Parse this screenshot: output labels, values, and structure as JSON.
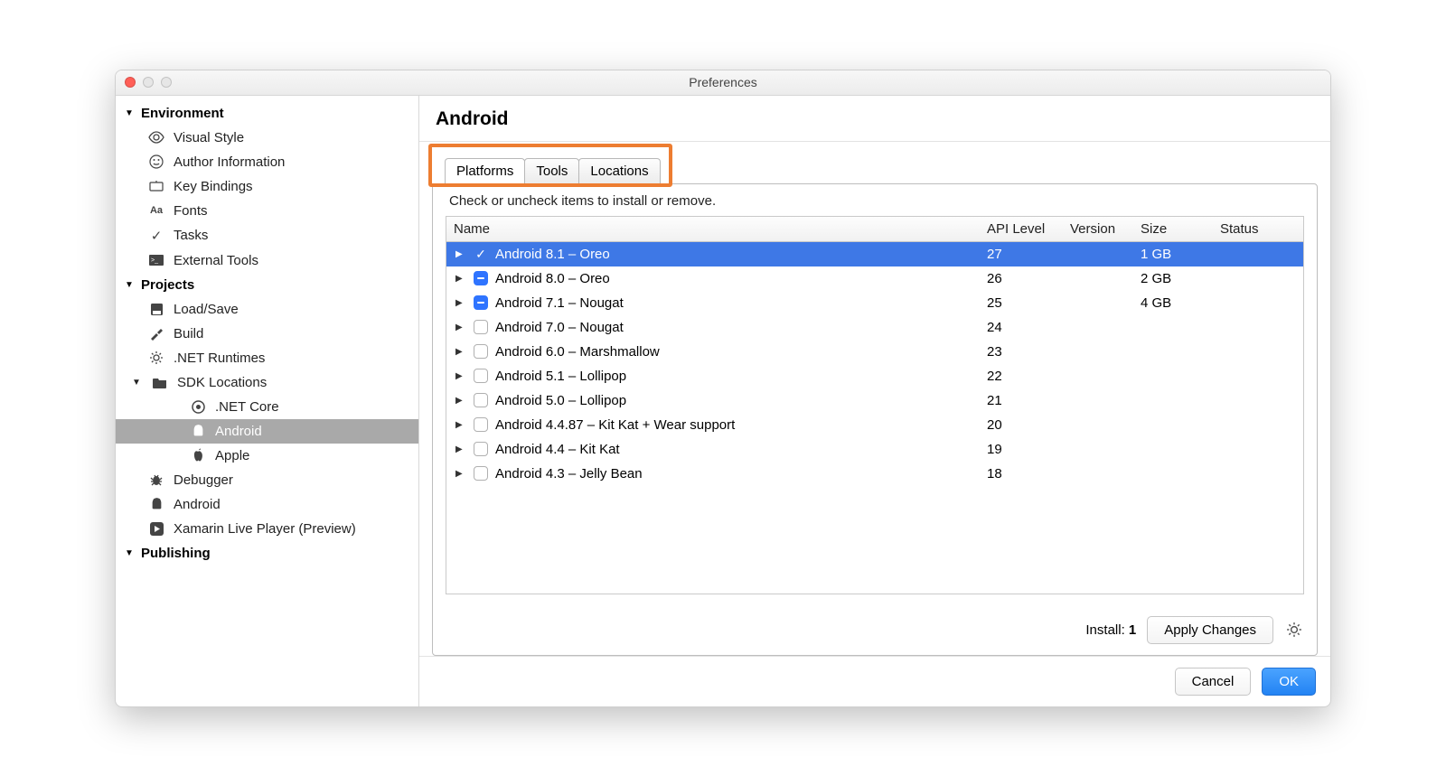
{
  "window": {
    "title": "Preferences"
  },
  "sidebar": {
    "sections": {
      "environment": {
        "label": "Environment",
        "items": [
          {
            "label": "Visual Style"
          },
          {
            "label": "Author Information"
          },
          {
            "label": "Key Bindings"
          },
          {
            "label": "Fonts"
          },
          {
            "label": "Tasks"
          },
          {
            "label": "External Tools"
          }
        ]
      },
      "projects": {
        "label": "Projects",
        "items": {
          "loadsave": {
            "label": "Load/Save"
          },
          "build": {
            "label": "Build"
          },
          "netruntimes": {
            "label": ".NET Runtimes"
          },
          "sdk": {
            "label": "SDK Locations",
            "children": {
              "netcore": {
                "label": ".NET Core"
              },
              "android": {
                "label": "Android"
              },
              "apple": {
                "label": "Apple"
              }
            }
          },
          "debugger": {
            "label": "Debugger"
          },
          "android2": {
            "label": "Android"
          },
          "xamarin": {
            "label": "Xamarin Live Player (Preview)"
          }
        }
      },
      "publishing": {
        "label": "Publishing"
      }
    }
  },
  "main": {
    "title": "Android",
    "tabs": {
      "platforms": "Platforms",
      "tools": "Tools",
      "locations": "Locations"
    },
    "hint": "Check or uncheck items to install or remove.",
    "columns": {
      "name": "Name",
      "api": "API Level",
      "version": "Version",
      "size": "Size",
      "status": "Status"
    },
    "rows": [
      {
        "check": "checked",
        "selected": true,
        "name": "Android 8.1 – Oreo",
        "api": "27",
        "version": "",
        "size": "1 GB",
        "status": ""
      },
      {
        "check": "mixed",
        "selected": false,
        "name": "Android 8.0 – Oreo",
        "api": "26",
        "version": "",
        "size": "2 GB",
        "status": ""
      },
      {
        "check": "mixed",
        "selected": false,
        "name": "Android 7.1 – Nougat",
        "api": "25",
        "version": "",
        "size": "4 GB",
        "status": ""
      },
      {
        "check": "empty",
        "selected": false,
        "name": "Android 7.0 – Nougat",
        "api": "24",
        "version": "",
        "size": "",
        "status": ""
      },
      {
        "check": "empty",
        "selected": false,
        "name": "Android 6.0 – Marshmallow",
        "api": "23",
        "version": "",
        "size": "",
        "status": ""
      },
      {
        "check": "empty",
        "selected": false,
        "name": "Android 5.1 – Lollipop",
        "api": "22",
        "version": "",
        "size": "",
        "status": ""
      },
      {
        "check": "empty",
        "selected": false,
        "name": "Android 5.0 – Lollipop",
        "api": "21",
        "version": "",
        "size": "",
        "status": ""
      },
      {
        "check": "empty",
        "selected": false,
        "name": "Android 4.4.87 – Kit Kat + Wear support",
        "api": "20",
        "version": "",
        "size": "",
        "status": ""
      },
      {
        "check": "empty",
        "selected": false,
        "name": "Android 4.4 – Kit Kat",
        "api": "19",
        "version": "",
        "size": "",
        "status": ""
      },
      {
        "check": "empty",
        "selected": false,
        "name": "Android 4.3 – Jelly Bean",
        "api": "18",
        "version": "",
        "size": "",
        "status": ""
      }
    ],
    "install_label": "Install:",
    "install_count": "1",
    "apply_changes": "Apply Changes"
  },
  "dialog": {
    "cancel": "Cancel",
    "ok": "OK"
  }
}
